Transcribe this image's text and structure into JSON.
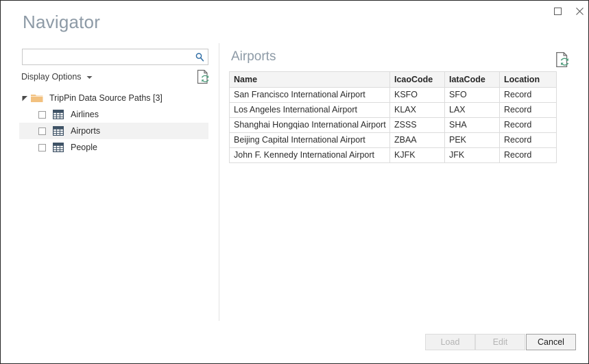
{
  "window": {
    "title": "Navigator",
    "caption_buttons": [
      {
        "name": "maximize",
        "icon": "maximize-icon",
        "label": "Maximize"
      },
      {
        "name": "close",
        "icon": "close-icon",
        "label": "Close"
      }
    ]
  },
  "search": {
    "value": "",
    "placeholder": "",
    "icon": "search-icon"
  },
  "display_options": {
    "label": "Display Options",
    "icon": "chevron-down-icon"
  },
  "refresh_icon_left": "refresh-document-icon",
  "refresh_icon_right": "refresh-document-icon",
  "tree": {
    "root": {
      "label": "TripPin Data Source Paths [3]",
      "icon": "folder-icon",
      "expander": "expander-expanded-icon",
      "expanded": true
    },
    "items": [
      {
        "label": "Airlines",
        "icon": "table-icon",
        "checked": false,
        "selected": false
      },
      {
        "label": "Airports",
        "icon": "table-icon",
        "checked": false,
        "selected": true
      },
      {
        "label": "People",
        "icon": "table-icon",
        "checked": false,
        "selected": false
      }
    ]
  },
  "preview": {
    "title": "Airports",
    "columns": [
      "Name",
      "IcaoCode",
      "IataCode",
      "Location"
    ],
    "rows": [
      [
        "San Francisco International Airport",
        "KSFO",
        "SFO",
        "Record"
      ],
      [
        "Los Angeles International Airport",
        "KLAX",
        "LAX",
        "Record"
      ],
      [
        "Shanghai Hongqiao International Airport",
        "ZSSS",
        "SHA",
        "Record"
      ],
      [
        "Beijing Capital International Airport",
        "ZBAA",
        "PEK",
        "Record"
      ],
      [
        "John F. Kennedy International Airport",
        "KJFK",
        "JFK",
        "Record"
      ]
    ]
  },
  "footer": {
    "load_label": "Load",
    "edit_label": "Edit",
    "cancel_label": "Cancel",
    "load_enabled": false,
    "edit_enabled": false,
    "cancel_enabled": true
  },
  "colors": {
    "title_text": "#8d9aa6",
    "folder": "#f2c17f",
    "table_icon": "#3f5366",
    "refresh_badge": "#4f9d7c",
    "selection": "#f2f2f2",
    "border": "#262626",
    "search_icon": "#2e6ca4"
  }
}
